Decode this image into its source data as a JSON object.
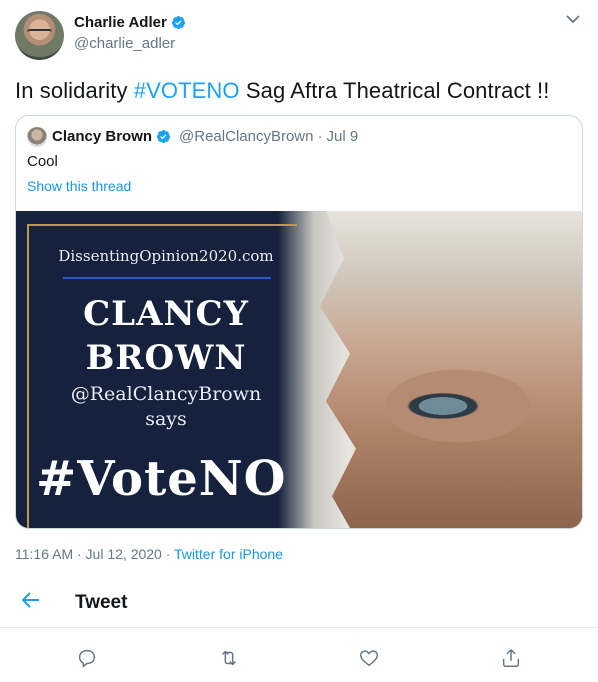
{
  "author": {
    "name": "Charlie Adler",
    "handle": "@charlie_adler"
  },
  "tweet": {
    "text_before": "In solidarity ",
    "hashtag": "#VOTENO",
    "text_after": " Sag Aftra Theatrical Contract !!"
  },
  "quoted_tweet": {
    "name": "Clancy Brown",
    "handle": "@RealClancyBrown",
    "separator": "·",
    "date": "Jul 9",
    "text": "Cool",
    "show_thread": "Show this thread",
    "media": {
      "site": "DissentingOpinion2020.com",
      "name_line1": "CLANCY",
      "name_line2": "BROWN",
      "handle": "@RealClancyBrown",
      "says": "says",
      "hashtag": "#VoteNO"
    }
  },
  "meta": {
    "time": "11:16 AM · Jul 12, 2020 · ",
    "source": "Twitter for iPhone"
  },
  "nav": {
    "title": "Tweet"
  },
  "icons": {
    "verified": "verified-badge-icon",
    "more": "chevron-down-icon",
    "back": "back-arrow-icon",
    "reply": "reply-icon",
    "retweet": "retweet-icon",
    "like": "like-icon",
    "share": "share-icon"
  },
  "colors": {
    "accent": "#1da1f2",
    "link": "#1b95e0",
    "muted": "#657786",
    "media_background": "#15213d"
  }
}
